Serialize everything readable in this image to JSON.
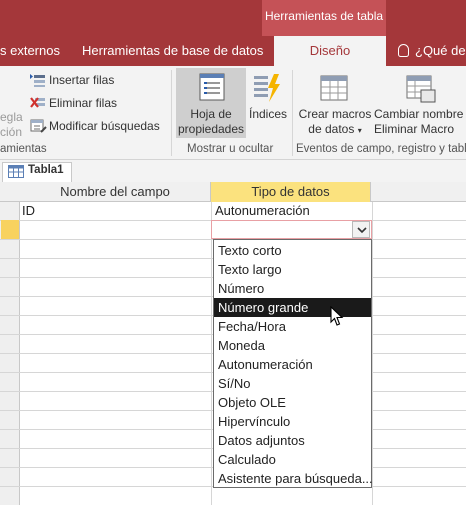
{
  "context_tab": "Herramientas de tabla",
  "tabs": {
    "external": "s externos",
    "dbtools": "Herramientas de base de datos",
    "design": "Diseño",
    "tell": "¿Qué des"
  },
  "ribbon": {
    "partial_top": "egla",
    "partial_mid": "ción",
    "partial_group": "amientas",
    "insert_rows": "Insertar filas",
    "delete_rows": "Eliminar filas",
    "modify_lookups": "Modificar búsquedas",
    "property_sheet_1": "Hoja de",
    "property_sheet_2": "propiedades",
    "indexes": "Índices",
    "create_macros_1": "Crear macros",
    "create_macros_2": "de datos",
    "rename_delete_1": "Cambiar nombre",
    "rename_delete_2": "Eliminar Macro",
    "group_show_hide": "Mostrar u ocultar",
    "group_events": "Eventos de campo, registro y tabla"
  },
  "object_tab": "Tabla1",
  "grid": {
    "header_field_name": "Nombre del campo",
    "header_data_type": "Tipo de datos",
    "row1_name": "ID",
    "row1_type": "Autonumeración"
  },
  "dropdown": {
    "options": [
      "Texto corto",
      "Texto largo",
      "Número",
      "Número grande",
      "Fecha/Hora",
      "Moneda",
      "Autonumeración",
      "Sí/No",
      "Objeto OLE",
      "Hipervínculo",
      "Datos adjuntos",
      "Calculado",
      "Asistente para búsqueda..."
    ],
    "selected": "Número grande"
  },
  "colors": {
    "accent": "#a4373a",
    "context": "#c55257",
    "header_highlight": "#fbe27e",
    "row_marker": "#f8d25f"
  }
}
